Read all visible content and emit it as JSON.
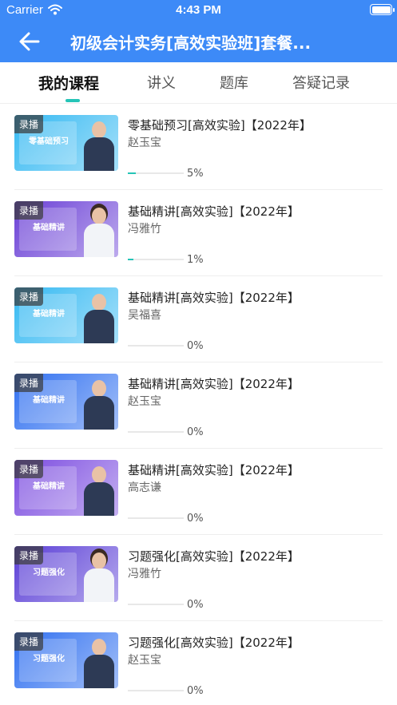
{
  "status_bar": {
    "carrier": "Carrier",
    "time": "4:43 PM"
  },
  "header": {
    "title": "初级会计实务[高效实验班]套餐..."
  },
  "tabs": [
    {
      "label": "我的课程",
      "active": true
    },
    {
      "label": "讲义",
      "active": false
    },
    {
      "label": "题库",
      "active": false
    },
    {
      "label": "答疑记录",
      "active": false
    }
  ],
  "courses": [
    {
      "title": "零基础预习[高效实验]【2022年】",
      "teacher": "赵玉宝",
      "progress_label": "5%",
      "progress": 0.05,
      "tag": "录播",
      "thumb_text": "零基础预习",
      "thumb_color": "#35b9f2",
      "gender": "m"
    },
    {
      "title": "基础精讲[高效实验]【2022年】",
      "teacher": "冯雅竹",
      "progress_label": "1%",
      "progress": 0.01,
      "tag": "录播",
      "thumb_text": "基础精讲",
      "thumb_color": "#6a3fd6",
      "gender": "f"
    },
    {
      "title": "基础精讲[高效实验]【2022年】",
      "teacher": "吴福喜",
      "progress_label": "0%",
      "progress": 0,
      "tag": "录播",
      "thumb_text": "基础精讲",
      "thumb_color": "#35b9f2",
      "gender": "m"
    },
    {
      "title": "基础精讲[高效实验]【2022年】",
      "teacher": "赵玉宝",
      "progress_label": "0%",
      "progress": 0,
      "tag": "录播",
      "thumb_text": "基础精讲",
      "thumb_color": "#2f6ff0",
      "gender": "m"
    },
    {
      "title": "基础精讲[高效实验]【2022年】",
      "teacher": "高志谦",
      "progress_label": "0%",
      "progress": 0,
      "tag": "录播",
      "thumb_text": "基础精讲",
      "thumb_color": "#7b4be0",
      "gender": "m"
    },
    {
      "title": "习题强化[高效实验]【2022年】",
      "teacher": "冯雅竹",
      "progress_label": "0%",
      "progress": 0,
      "tag": "录播",
      "thumb_text": "习题强化",
      "thumb_color": "#5a3ed6",
      "gender": "f"
    },
    {
      "title": "习题强化[高效实验]【2022年】",
      "teacher": "赵玉宝",
      "progress_label": "0%",
      "progress": 0,
      "tag": "录播",
      "thumb_text": "习题强化",
      "thumb_color": "#2f6ff0",
      "gender": "m"
    }
  ],
  "colors": {
    "header": "#3d8af7",
    "accent": "#25c4b7"
  },
  "icons": {
    "back": "arrow-left-icon",
    "wifi": "wifi-icon",
    "battery": "battery-icon"
  }
}
